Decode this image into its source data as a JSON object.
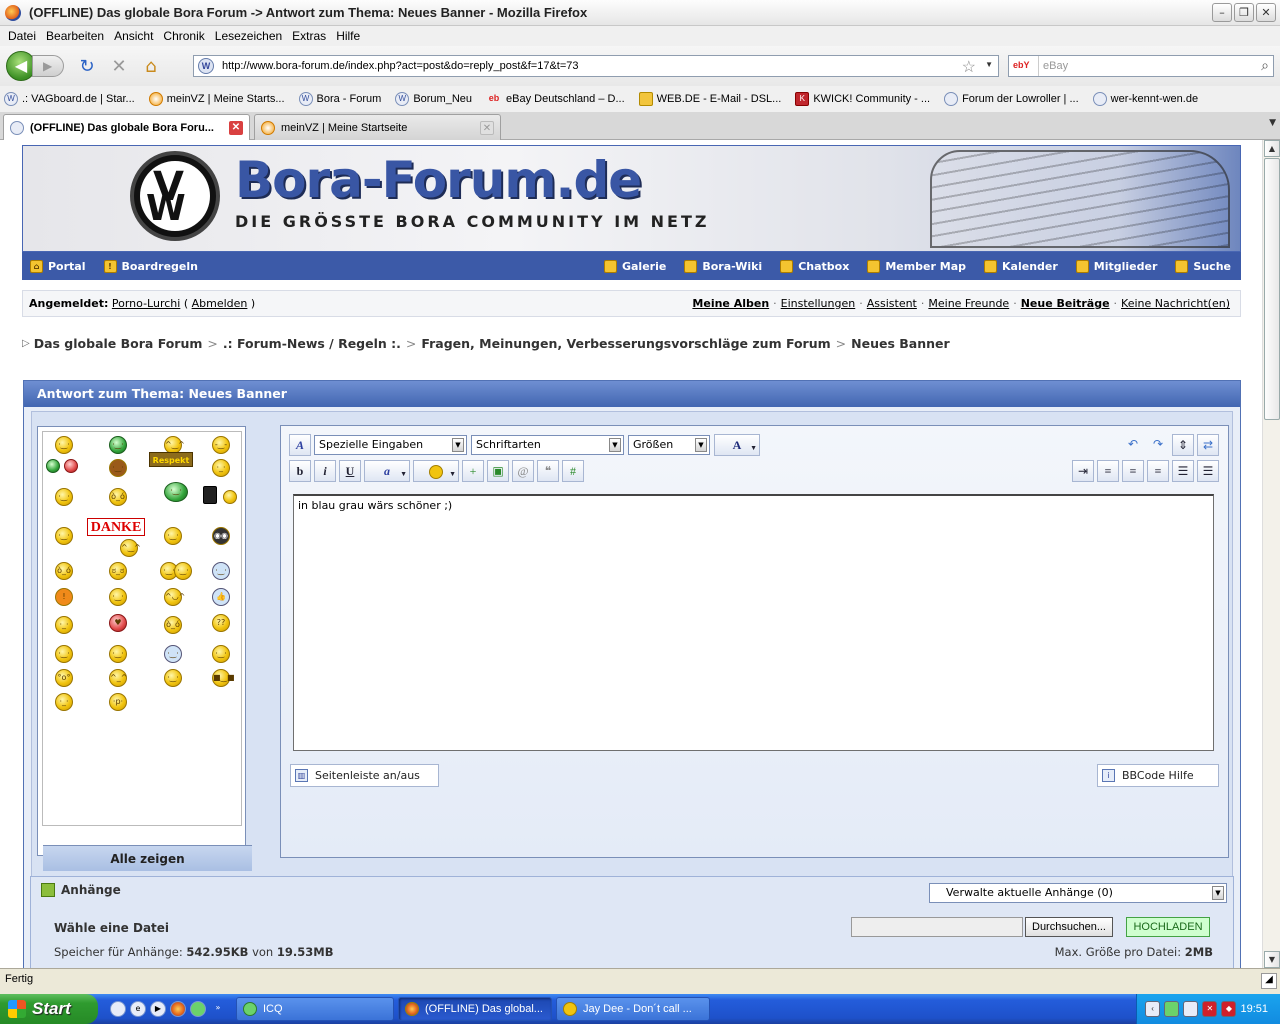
{
  "window": {
    "title": "(OFFLINE) Das globale Bora Forum -> Antwort zum Thema: Neues Banner - Mozilla Firefox"
  },
  "menu": [
    "Datei",
    "Bearbeiten",
    "Ansicht",
    "Chronik",
    "Lesezeichen",
    "Extras",
    "Hilfe"
  ],
  "nav": {
    "url": "http://www.bora-forum.de/index.php?act=post&do=reply_post&f=17&t=73",
    "search_engine": "ebY",
    "search_placeholder": "eBay"
  },
  "bookmarks": [
    ".: VAGboard.de | Star...",
    "meinVZ | Meine Starts...",
    "Bora - Forum",
    "Borum_Neu",
    "eBay Deutschland – D...",
    "WEB.DE - E-Mail - DSL...",
    "KWICK! Community - ...",
    "Forum der Lowroller | ...",
    "wer-kennt-wen.de"
  ],
  "tabs": [
    {
      "label": "(OFFLINE) Das globale Bora Foru..."
    },
    {
      "label": "meinVZ | Meine Startseite"
    }
  ],
  "site": {
    "banner_title": "Bora-Forum.de",
    "banner_sub": "DIE GRÖSSTE BORA COMMUNITY IM NETZ",
    "nav_left": [
      "Portal",
      "Boardregeln"
    ],
    "nav_right": [
      "Galerie",
      "Bora-Wiki",
      "Chatbox",
      "Member Map",
      "Kalender",
      "Mitglieder",
      "Suche"
    ],
    "logged_in_label": "Angemeldet:",
    "username": "Porno-Lurchi",
    "logout": "Abmelden",
    "user_links": [
      "Meine Alben",
      "Einstellungen",
      "Assistent",
      "Meine Freunde",
      "Neue Beiträge",
      "Keine Nachricht(en)"
    ],
    "breadcrumb": [
      "Das globale Bora Forum",
      ".: Forum-News / Regeln :.",
      "Fragen, Meinungen, Verbesserungsvorschläge zum Forum",
      "Neues Banner"
    ]
  },
  "form": {
    "header": "Antwort zum Thema: Neues Banner",
    "show_all": "Alle zeigen",
    "respekt": "Respekt",
    "danke": "DANKE",
    "select_special": "Spezielle Eingaben",
    "select_font": "Schriftarten",
    "select_size": "Größen",
    "bold": "b",
    "italic": "i",
    "underline": "u",
    "message": "in blau grau wärs schöner ;)",
    "sidebar_toggle": "Seitenleiste an/aus",
    "bbcode_help": "BBCode Hilfe"
  },
  "attachments": {
    "header": "Anhänge",
    "manage": "Verwalte aktuelle Anhänge (0)",
    "choose": "Wähle eine Datei",
    "storage_prefix": "Speicher für Anhänge:",
    "storage_used": "542.95KB",
    "storage_of": "von",
    "storage_total": "19.53MB",
    "browse": "Durchsuchen...",
    "upload": "HOCHLADEN",
    "max_label": "Max. Größe pro Datei:",
    "max_value": "2MB"
  },
  "status": "Fertig",
  "taskbar": {
    "start": "Start",
    "items": [
      "ICQ",
      "(OFFLINE) Das global...",
      "Jay Dee - Don´t call ..."
    ],
    "clock": "19:51"
  }
}
